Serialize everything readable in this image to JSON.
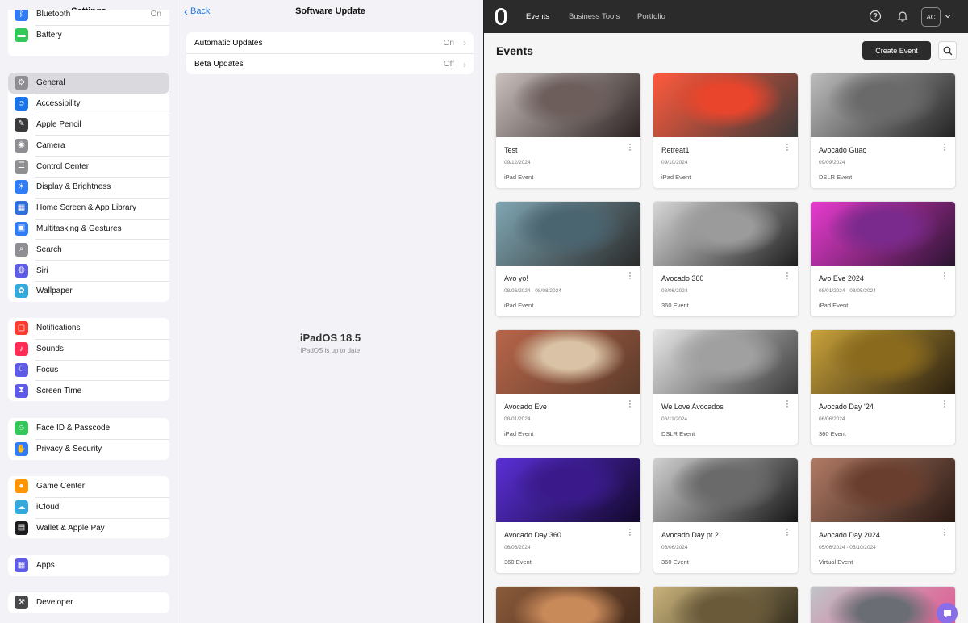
{
  "settings": {
    "title": "Settings",
    "groups": [
      {
        "items": [
          {
            "label": "Bluetooth",
            "value": "On",
            "icon": "bluetooth-icon",
            "color": "#2f7cf6",
            "glyph": "ᛒ"
          },
          {
            "label": "Battery",
            "icon": "battery-icon",
            "color": "#34c759",
            "glyph": "▬"
          }
        ]
      },
      {
        "items": [
          {
            "label": "General",
            "icon": "gear-icon",
            "color": "#8e8e93",
            "glyph": "⚙",
            "active": true
          },
          {
            "label": "Accessibility",
            "icon": "accessibility-icon",
            "color": "#1a73e8",
            "glyph": "☺"
          },
          {
            "label": "Apple Pencil",
            "icon": "pencil-icon",
            "color": "#3a3a3c",
            "glyph": "✎"
          },
          {
            "label": "Camera",
            "icon": "camera-icon",
            "color": "#8e8e93",
            "glyph": "◉"
          },
          {
            "label": "Control Center",
            "icon": "control-center-icon",
            "color": "#8e8e93",
            "glyph": "☰"
          },
          {
            "label": "Display & Brightness",
            "icon": "brightness-icon",
            "color": "#2f7cf6",
            "glyph": "☀"
          },
          {
            "label": "Home Screen & App Library",
            "icon": "home-screen-icon",
            "color": "#2f6fdb",
            "glyph": "▦"
          },
          {
            "label": "Multitasking & Gestures",
            "icon": "multitasking-icon",
            "color": "#2f7cf6",
            "glyph": "▣"
          },
          {
            "label": "Search",
            "icon": "search-icon",
            "color": "#8e8e93",
            "glyph": "⌕"
          },
          {
            "label": "Siri",
            "icon": "siri-icon",
            "color": "#5e5ce6",
            "glyph": "◍"
          },
          {
            "label": "Wallpaper",
            "icon": "wallpaper-icon",
            "color": "#34aadc",
            "glyph": "✿"
          }
        ]
      },
      {
        "items": [
          {
            "label": "Notifications",
            "icon": "notifications-icon",
            "color": "#ff3b30",
            "glyph": "▢"
          },
          {
            "label": "Sounds",
            "icon": "sounds-icon",
            "color": "#ff2d55",
            "glyph": "♪"
          },
          {
            "label": "Focus",
            "icon": "focus-icon",
            "color": "#5e5ce6",
            "glyph": "☾"
          },
          {
            "label": "Screen Time",
            "icon": "screen-time-icon",
            "color": "#5e5ce6",
            "glyph": "⧗"
          }
        ]
      },
      {
        "items": [
          {
            "label": "Face ID & Passcode",
            "icon": "face-id-icon",
            "color": "#34c759",
            "glyph": "☺"
          },
          {
            "label": "Privacy & Security",
            "icon": "privacy-icon",
            "color": "#2f7cf6",
            "glyph": "✋"
          }
        ]
      },
      {
        "items": [
          {
            "label": "Game Center",
            "icon": "game-center-icon",
            "color": "#ff9500",
            "glyph": "●"
          },
          {
            "label": "iCloud",
            "icon": "icloud-icon",
            "color": "#34aadc",
            "glyph": "☁"
          },
          {
            "label": "Wallet & Apple Pay",
            "icon": "wallet-icon",
            "color": "#1c1c1e",
            "glyph": "▤"
          }
        ]
      },
      {
        "items": [
          {
            "label": "Apps",
            "icon": "apps-icon",
            "color": "#5e5ce6",
            "glyph": "▦"
          }
        ]
      },
      {
        "items": [
          {
            "label": "Developer",
            "icon": "developer-icon",
            "color": "#48484a",
            "glyph": "⚒"
          }
        ]
      }
    ]
  },
  "software_update": {
    "back_label": "Back",
    "title": "Software Update",
    "rows": [
      {
        "label": "Automatic Updates",
        "value": "On"
      },
      {
        "label": "Beta Updates",
        "value": "Off"
      }
    ],
    "os_version": "iPadOS 18.5",
    "os_status": "iPadOS is up to date"
  },
  "app": {
    "nav": [
      {
        "label": "Events",
        "active": true
      },
      {
        "label": "Business Tools",
        "active": false
      },
      {
        "label": "Portfolio",
        "active": false
      }
    ],
    "help_icon": "help-icon",
    "bell_icon": "bell-icon",
    "avatar_initials": "AC",
    "page_title": "Events",
    "create_label": "Create Event",
    "events": [
      {
        "name": "Test",
        "date": "09/12/2024",
        "type": "iPad Event",
        "thumb": [
          "#c9c0bd",
          "#6d5e5c",
          "#2b2221"
        ]
      },
      {
        "name": "Retreat1",
        "date": "09/10/2024",
        "type": "iPad Event",
        "thumb": [
          "#ff5a3c",
          "#e8452c",
          "#3a3a3a"
        ]
      },
      {
        "name": "Avocado Guac",
        "date": "09/09/2024",
        "type": "DSLR Event",
        "thumb": [
          "#bdbdbd",
          "#6a6a6a",
          "#222222"
        ]
      },
      {
        "name": "Avo yo!",
        "date": "08/06/2024 - 08/08/2024",
        "type": "iPad Event",
        "thumb": [
          "#7fa6b3",
          "#4a6470",
          "#2a2a2a"
        ]
      },
      {
        "name": "Avocado 360",
        "date": "08/06/2024",
        "type": "360 Event",
        "thumb": [
          "#d7d7d7",
          "#9b9b9b",
          "#1e1e1e"
        ]
      },
      {
        "name": "Avo Eve 2024",
        "date": "08/01/2024 - 08/05/2024",
        "type": "iPad Event",
        "thumb": [
          "#e83bd0",
          "#7a2a8c",
          "#2a1430"
        ]
      },
      {
        "name": "Avocado Eve",
        "date": "08/01/2024",
        "type": "iPad Event",
        "thumb": [
          "#b8664a",
          "#d9c2a5",
          "#5a3a2a"
        ]
      },
      {
        "name": "We Love Avocados",
        "date": "06/11/2024",
        "type": "DSLR Event",
        "thumb": [
          "#e6e6e6",
          "#a0a0a0",
          "#3a3a3a"
        ]
      },
      {
        "name": "Avocado Day ‘24",
        "date": "06/06/2024",
        "type": "360 Event",
        "thumb": [
          "#c9a23a",
          "#8a6a1c",
          "#2b2010"
        ]
      },
      {
        "name": "Avocado Day 360",
        "date": "06/06/2024",
        "type": "360 Event",
        "thumb": [
          "#5a2fd8",
          "#3a1a8a",
          "#12082a"
        ]
      },
      {
        "name": "Avocado Day pt 2",
        "date": "06/06/2024",
        "type": "360 Event",
        "thumb": [
          "#d0d0d0",
          "#6a6a6a",
          "#151515"
        ]
      },
      {
        "name": "Avocado Day 2024",
        "date": "05/06/2024 - 05/10/2024",
        "type": "Virtual Event",
        "thumb": [
          "#b07a64",
          "#6a3e2e",
          "#2a1a14"
        ]
      },
      {
        "name": "",
        "date": "",
        "type": "",
        "thumb": [
          "#8a5a3a",
          "#c98a5a",
          "#3a2418"
        ]
      },
      {
        "name": "",
        "date": "",
        "type": "",
        "thumb": [
          "#c9b27a",
          "#6a5a3a",
          "#1e1a10"
        ]
      },
      {
        "name": "",
        "date": "",
        "type": "",
        "thumb": [
          "#c0c4c8",
          "#6a6e74",
          "#e64b8a"
        ]
      }
    ]
  },
  "colors": {
    "ios_link": "#2a7ae2",
    "app_topbar": "#2b2b2b",
    "chat_button": "#8a6ee8"
  }
}
